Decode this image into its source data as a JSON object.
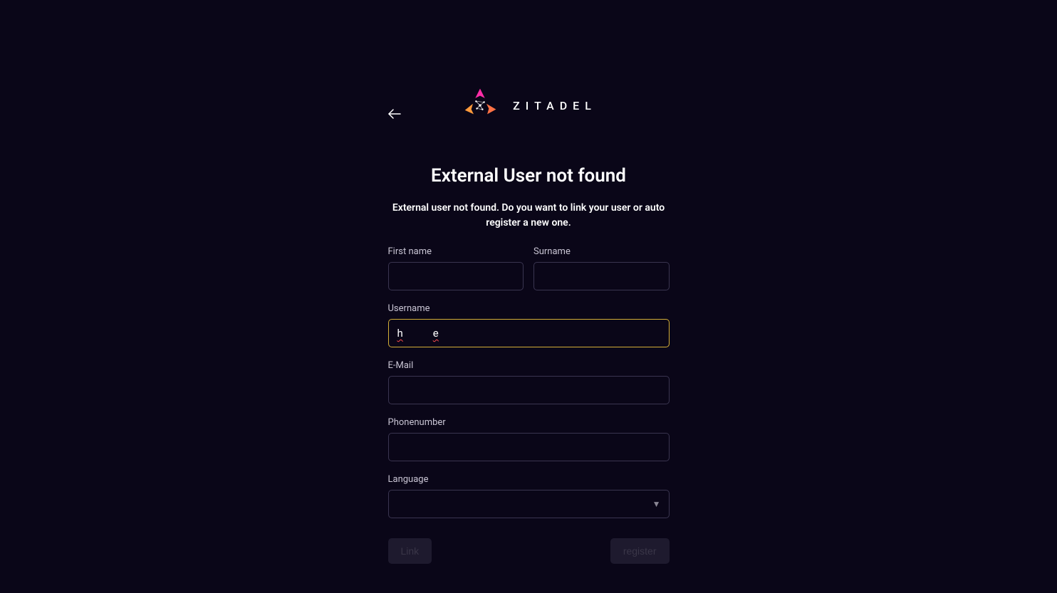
{
  "brand": {
    "name": "ZITADEL"
  },
  "page": {
    "title": "External User not found",
    "subtitle": "External user not found. Do you want to link your user or auto register a new one."
  },
  "form": {
    "first_name_label": "First name",
    "first_name_value": "",
    "surname_label": "Surname",
    "surname_value": "",
    "username_label": "Username",
    "username_part1": "h",
    "username_part2": "e",
    "email_label": "E-Mail",
    "email_value": "",
    "phone_label": "Phonenumber",
    "phone_value": "",
    "language_label": "Language",
    "language_value": ""
  },
  "actions": {
    "link_label": "Link",
    "register_label": "register"
  }
}
